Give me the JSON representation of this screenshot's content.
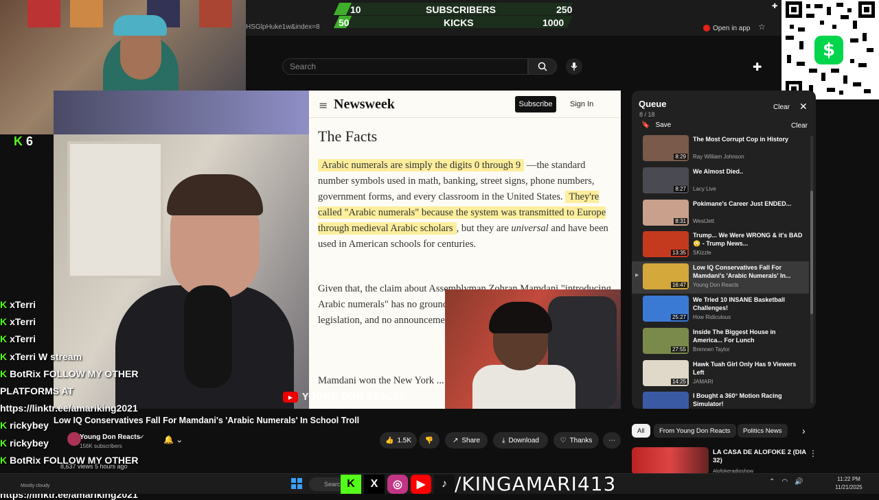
{
  "kick_goal": {
    "rows": [
      {
        "left": "10",
        "label": "SUBSCRIBERS",
        "right": "250",
        "progress": 0.04
      },
      {
        "left": "50",
        "label": "KICKS",
        "right": "1000",
        "progress": 0.05
      }
    ]
  },
  "browser": {
    "url_fragment": "HSGlpHuke1w&index=8",
    "open_in_app": "Open in app"
  },
  "youtube": {
    "search_placeholder": "Search"
  },
  "article": {
    "logo": "Newsweek",
    "subscribe": "Subscribe",
    "sign_in": "Sign In",
    "heading": "The Facts",
    "p1_hl1": "Arabic numerals are simply the digits 0 through 9",
    "p1_rest1": " —the standard number symbols used in math, banking, street signs, phone numbers, government forms, and every classroom in the United States. ",
    "p1_hl2": "They're called \"Arabic numerals\" because the system was transmitted to Europe through medieval Arabic scholars",
    "p1_rest2": ", but they are ",
    "p1_em": "universal",
    "p1_rest3": " and have been used in American schools for centuries.",
    "p2": "Given that, the claim about Assemblyman Zohran Mamdani \"introducing Arabic numerals\" has no grounding in reality. There is no bill, legislation, and no announcement related to numerals of any kind.",
    "p3": "Mamdani won the New York ... former Go..."
  },
  "watermark": "YOUNG DON REACTS",
  "queue": {
    "title": "Queue",
    "count": "8 / 18",
    "clear": "Clear",
    "save": "Save",
    "clear2": "Clear",
    "items": [
      {
        "title": "The Most Corrupt Cop in History",
        "channel": "Ray William Johnson",
        "duration": "8:29",
        "color": "#7a5a4a"
      },
      {
        "title": "We Almost Died..",
        "channel": "Lacy Live",
        "duration": "8:27",
        "color": "#4a4a52"
      },
      {
        "title": "Pokimane's Career Just ENDED...",
        "channel": "WestJett",
        "duration": "8:31",
        "color": "#c9a08c"
      },
      {
        "title": "Trump... We Were WRONG & it's BAD 😳 - Trump News...",
        "channel": "SKizzle",
        "duration": "13:35",
        "color": "#c43a1f"
      },
      {
        "title": "Low IQ Conservatives Fall For Mamdani's 'Arabic Numerals' In...",
        "channel": "Young Don Reacts",
        "duration": "16:47",
        "color": "#d4a83a"
      },
      {
        "title": "We Tried 10 INSANE Basketball Challenges!",
        "channel": "How Ridiculous",
        "duration": "25:27",
        "color": "#3a7ad4"
      },
      {
        "title": "Inside The Biggest House in America... For Lunch",
        "channel": "Brennen Taylor",
        "duration": "27:55",
        "color": "#7a8a4a"
      },
      {
        "title": "Hawk Tuah Girl Only Has 9 Viewers Left",
        "channel": "JAMARI",
        "duration": "14:25",
        "color": "#e0d8c8"
      },
      {
        "title": "I Bought a 360° Motion Racing Simulator!",
        "channel": "Driving Dad",
        "duration": "23:34",
        "color": "#3a5aa4"
      }
    ]
  },
  "chips": [
    "All",
    "From Young Don Reacts",
    "Politics News"
  ],
  "recommended": {
    "title": "LA CASA DE ALOFOKE 2 (DIA 32)",
    "channel": "Alofokeradioshow"
  },
  "video": {
    "title": "Low IQ Conservatives Fall For Mamdani's 'Arabic Numerals' In School Troll",
    "channel": "Young Don Reacts",
    "subs": "156K subscribers",
    "meta": "8,637 views 5 hours ago",
    "likes": "1.5K",
    "share": "Share",
    "download": "Download",
    "thanks": "Thanks"
  },
  "chat": {
    "kick_count": "6",
    "lines": [
      {
        "user": "xTerri",
        "msg": ""
      },
      {
        "user": "xTerri",
        "msg": ""
      },
      {
        "user": "xTerri",
        "msg": ""
      },
      {
        "user": "xTerri",
        "msg": "W stream"
      },
      {
        "user": "BotRix",
        "msg": "FOLLOW MY OTHER"
      },
      {
        "user": "",
        "msg": "PLATFORMS AT"
      },
      {
        "user": "",
        "msg": "https://linktr.ee/amariking2021"
      },
      {
        "user": "rickybey",
        "msg": ""
      },
      {
        "user": "rickybey",
        "msg": ""
      },
      {
        "user": "BotRix",
        "msg": "FOLLOW MY OTHER"
      },
      {
        "user": "",
        "msg": "PLATFORMS AT"
      },
      {
        "user": "",
        "msg": "https://linktr.ee/amariking2021"
      }
    ]
  },
  "taskbar": {
    "weather": "Mostly cloudy",
    "search": "Search",
    "handle": "/KINGAMARI413",
    "time": "11:22 PM",
    "date": "11/21/2025"
  },
  "colors": {
    "kick_green": "#53fc18",
    "yt_red": "#e62117",
    "highlight": "#fcee9c",
    "cashapp": "#00d54b"
  }
}
